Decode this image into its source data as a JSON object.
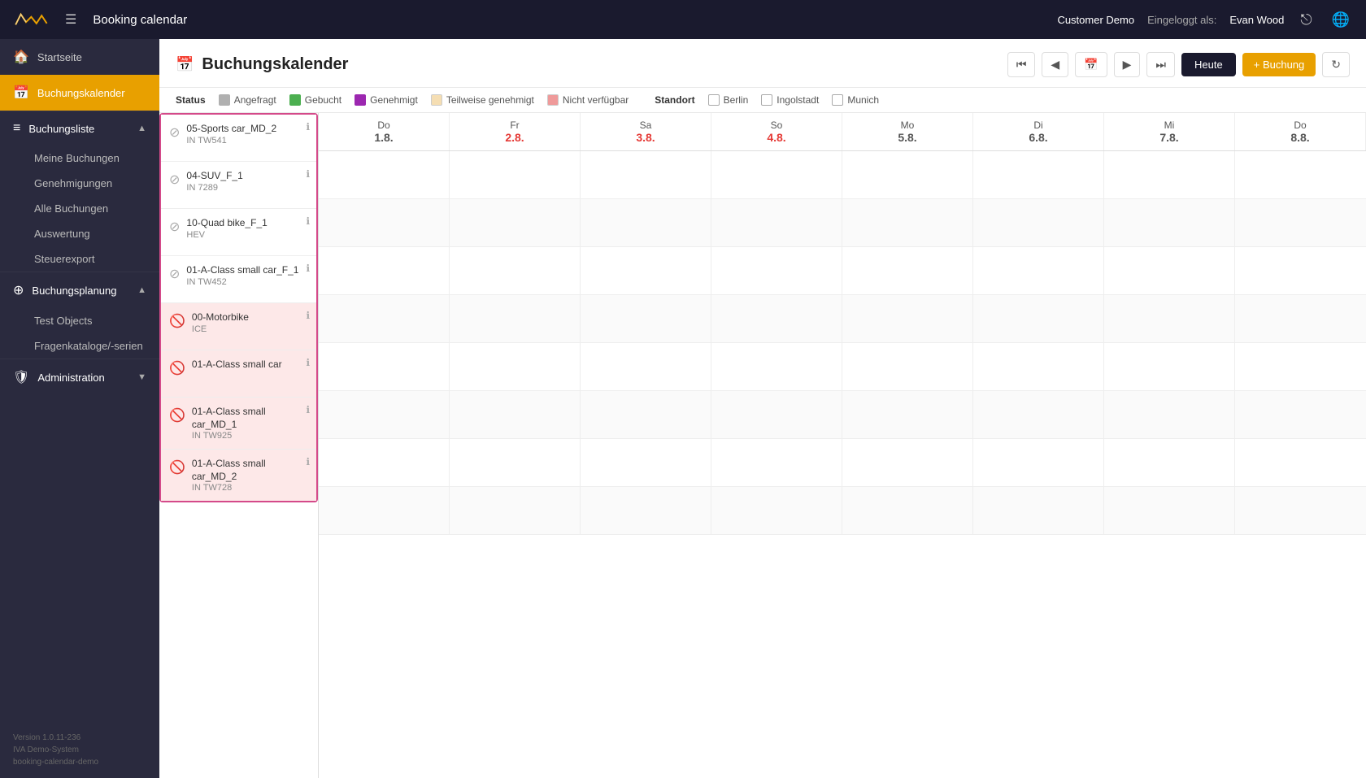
{
  "topbar": {
    "title": "Booking calendar",
    "customer": "Customer Demo",
    "logged_in_label": "Eingeloggt als:",
    "username": "Evan Wood"
  },
  "sidebar": {
    "items": [
      {
        "id": "startseite",
        "label": "Startseite",
        "icon": "🏠",
        "active": false
      },
      {
        "id": "buchungskalender",
        "label": "Buchungskalender",
        "icon": "📅",
        "active": true
      },
      {
        "id": "buchungsliste",
        "label": "Buchungsliste",
        "icon": "☰",
        "active": false,
        "expandable": true
      },
      {
        "id": "meine-buchungen",
        "label": "Meine Buchungen",
        "sub": true
      },
      {
        "id": "genehmigungen",
        "label": "Genehmigungen",
        "sub": true
      },
      {
        "id": "alle-buchungen",
        "label": "Alle Buchungen",
        "sub": true
      },
      {
        "id": "auswertung",
        "label": "Auswertung",
        "sub": true
      },
      {
        "id": "steuerexport",
        "label": "Steuerexport",
        "sub": true
      },
      {
        "id": "buchungsplanung",
        "label": "Buchungsplanung",
        "icon": "⊕",
        "active": false,
        "expandable": true
      },
      {
        "id": "test-objects",
        "label": "Test Objects",
        "sub": true
      },
      {
        "id": "fragenkataloge",
        "label": "Fragenkataloge/-serien",
        "sub": true
      },
      {
        "id": "administration",
        "label": "Administration",
        "icon": "🛡",
        "active": false,
        "expandable": true
      }
    ],
    "footer": {
      "version": "Version 1.0.11-236",
      "system": "IVA Demo-System",
      "instance": "booking-calendar-demo"
    }
  },
  "page": {
    "title": "Buchungskalender",
    "title_icon": "📅"
  },
  "controls": {
    "today_label": "Heute",
    "booking_label": "+ Buchung",
    "refresh_icon": "↻"
  },
  "legend": {
    "status_label": "Status",
    "items": [
      {
        "label": "Angefragt",
        "color": "#b0b0b0"
      },
      {
        "label": "Gebucht",
        "color": "#4caf50"
      },
      {
        "label": "Genehmigt",
        "color": "#9c27b0"
      },
      {
        "label": "Teilweise genehmigt",
        "color": "#f5deb3"
      },
      {
        "label": "Nicht verfügbar",
        "color": "#ef9a9a"
      }
    ],
    "standort_label": "Standort",
    "standort_items": [
      {
        "label": "Berlin",
        "color": "#fff",
        "border": true
      },
      {
        "label": "Ingolstadt",
        "color": "#fff",
        "border": true
      },
      {
        "label": "Munich",
        "color": "#fff",
        "border": true
      }
    ]
  },
  "calendar": {
    "days": [
      {
        "name": "Do",
        "num": "1.8.",
        "red": false
      },
      {
        "name": "Fr",
        "num": "2.8.",
        "red": true
      },
      {
        "name": "Sa",
        "num": "3.8.",
        "red": true
      },
      {
        "name": "So",
        "num": "4.8.",
        "red": true
      },
      {
        "name": "Mo",
        "num": "5.8.",
        "red": false
      },
      {
        "name": "Di",
        "num": "6.8.",
        "red": false
      },
      {
        "name": "Mi",
        "num": "7.8.",
        "red": false
      },
      {
        "name": "Do",
        "num": "8.8.",
        "red": false
      }
    ]
  },
  "resources": [
    {
      "id": 1,
      "name": "05-Sports car_MD_2",
      "sub": "IN TW541",
      "inactive": false
    },
    {
      "id": 2,
      "name": "04-SUV_F_1",
      "sub": "IN 7289",
      "inactive": false
    },
    {
      "id": 3,
      "name": "10-Quad bike_F_1",
      "sub": "HEV",
      "inactive": false
    },
    {
      "id": 4,
      "name": "01-A-Class small car_F_1",
      "sub": "IN TW452",
      "inactive": false
    },
    {
      "id": 5,
      "name": "00-Motorbike",
      "sub": "ICE",
      "inactive": true
    },
    {
      "id": 6,
      "name": "01-A-Class small car",
      "sub": "",
      "inactive": true
    },
    {
      "id": 7,
      "name": "01-A-Class small car_MD_1",
      "sub": "IN TW925",
      "inactive": true
    },
    {
      "id": 8,
      "name": "01-A-Class small car_MD_2",
      "sub": "IN TW728",
      "inactive": true
    }
  ]
}
